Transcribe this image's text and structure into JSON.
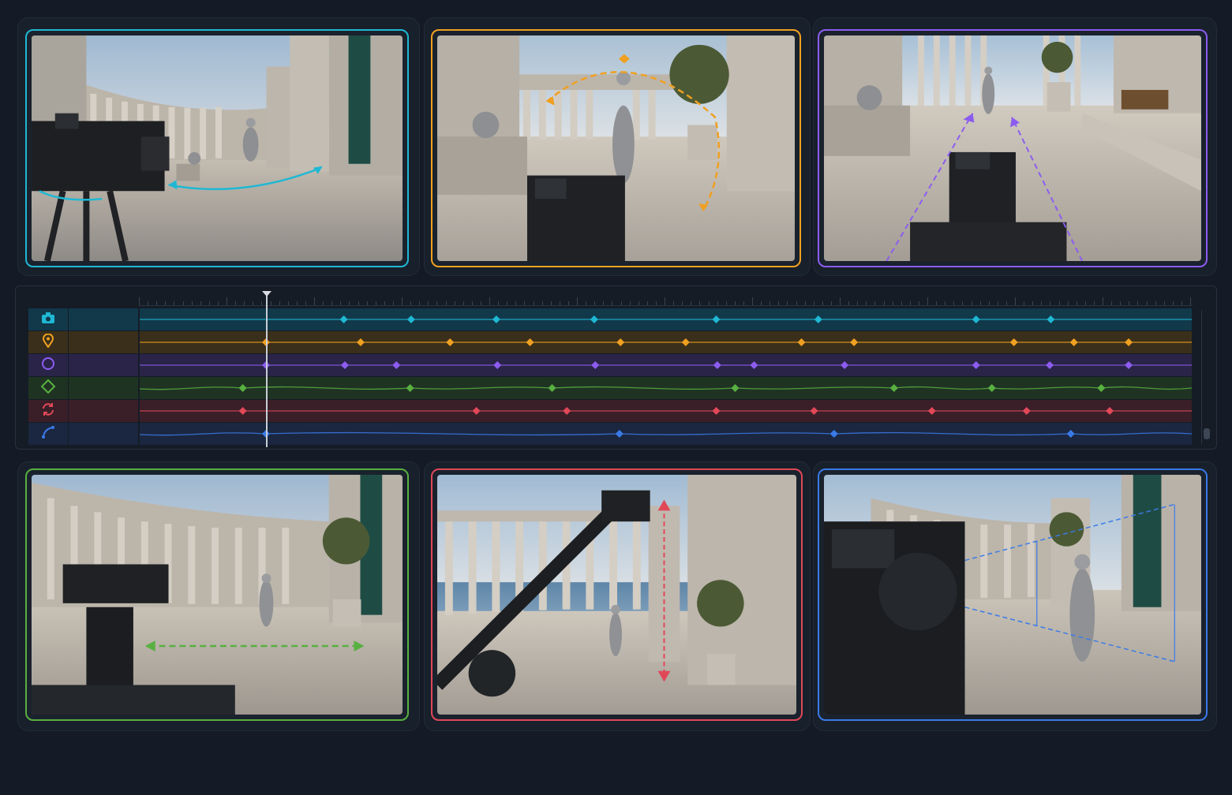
{
  "app": {
    "background": "#141b26"
  },
  "viewports": [
    {
      "id": "orbit",
      "accent": "#1fb8d4",
      "move": "orbit-arc-icon"
    },
    {
      "id": "crane-arc",
      "accent": "#f0a020",
      "move": "arc-dashed-icon"
    },
    {
      "id": "dolly-in",
      "accent": "#8c5cf0",
      "move": "dolly-arrows-icon"
    },
    {
      "id": "truck",
      "accent": "#58b040",
      "move": "truck-arrow-icon"
    },
    {
      "id": "jib",
      "accent": "#e04858",
      "move": "vertical-arrow-icon"
    },
    {
      "id": "zoom",
      "accent": "#3a7ae8",
      "move": "frustum-lines-icon"
    }
  ],
  "timeline": {
    "playhead_fraction": 0.12,
    "tracks": [
      {
        "id": "camera",
        "icon": "camera-icon",
        "color": "#1fb8d4",
        "row_bg": "#11394a",
        "keyframes": [
          0.194,
          0.258,
          0.339,
          0.432,
          0.548,
          0.645,
          0.795,
          0.866
        ]
      },
      {
        "id": "position",
        "icon": "location-pin-icon",
        "color": "#f0a020",
        "row_bg": "#3a2f1a",
        "keyframes": [
          0.12,
          0.21,
          0.295,
          0.371,
          0.457,
          0.519,
          0.629,
          0.679,
          0.831,
          0.888,
          0.94
        ]
      },
      {
        "id": "focus",
        "icon": "circle-icon",
        "color": "#8c5cf0",
        "row_bg": "#2a2448",
        "keyframes": [
          0.12,
          0.195,
          0.244,
          0.34,
          0.433,
          0.549,
          0.584,
          0.67,
          0.795,
          0.865,
          0.94
        ]
      },
      {
        "id": "keyframe",
        "icon": "diamond-icon",
        "color": "#58b040",
        "row_bg": "#1f3323",
        "keyframes": [
          0.098,
          0.257,
          0.392,
          0.566,
          0.717,
          0.81,
          0.914
        ]
      },
      {
        "id": "loop",
        "icon": "refresh-icon",
        "color": "#e04858",
        "row_bg": "#3a1f28",
        "keyframes": [
          0.098,
          0.32,
          0.406,
          0.548,
          0.641,
          0.753,
          0.843,
          0.922
        ]
      },
      {
        "id": "path",
        "icon": "curve-path-icon",
        "color": "#3a7ae8",
        "row_bg": "#1b2740",
        "keyframes": [
          0.12,
          0.456,
          0.66,
          0.885
        ]
      }
    ]
  }
}
